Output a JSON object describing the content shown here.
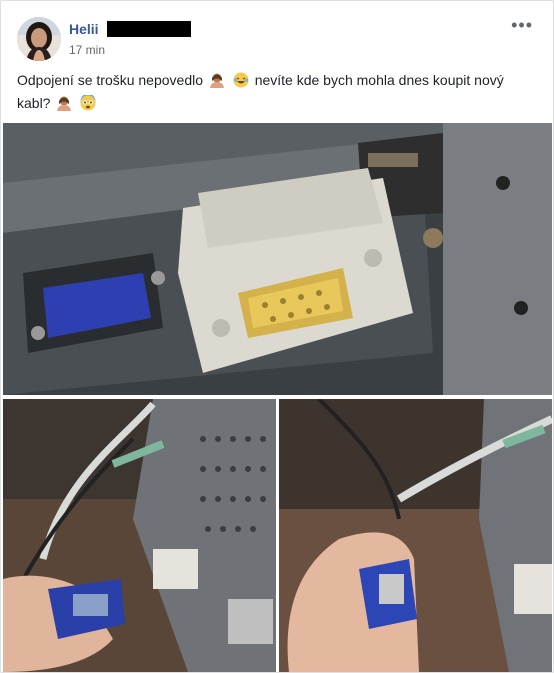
{
  "post": {
    "author_name": "Helii",
    "timestamp": "17 min",
    "more_label": "•••",
    "text_part1": "Odpojení se trošku nepovedlo",
    "text_part2": "nevíte kde bych mohla dnes koupit nový kabl?",
    "emojis": [
      "person-shrugging-icon",
      "laughing-tears-icon",
      "person-shrugging-icon",
      "flushed-face-icon"
    ]
  },
  "colors": {
    "link": "#385898",
    "text": "#1d2129",
    "meta": "#616770",
    "border": "#dddfe2",
    "background": "#e9ebee"
  }
}
